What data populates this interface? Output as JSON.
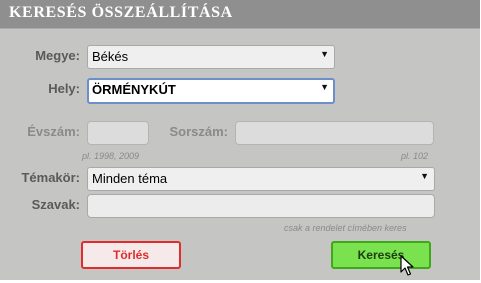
{
  "header": {
    "title": "KERESÉS ÖSSZEÁLLÍTÁSA"
  },
  "form": {
    "megye": {
      "label": "Megye:",
      "value": "Békés"
    },
    "hely": {
      "label": "Hely:",
      "value": "ÖRMÉNYKÚT"
    },
    "evszam": {
      "label": "Évszám:",
      "value": "",
      "hint": "pl. 1998, 2009"
    },
    "sorszam": {
      "label": "Sorszám:",
      "value": "",
      "hint": "pl. 102"
    },
    "temakor": {
      "label": "Témakör:",
      "value": "Minden téma"
    },
    "szavak": {
      "label": "Szavak:",
      "value": "",
      "hint": "csak a rendelet címében keres"
    }
  },
  "buttons": {
    "clear": "Törlés",
    "search": "Keresés"
  },
  "icons": {
    "dropdown": "▼",
    "cursor": "mouse-pointer-icon"
  },
  "colors": {
    "header_bg": "#8f8f8f",
    "panel_bg": "#c5c5c4",
    "clear_border": "#e02c2c",
    "search_bg": "#79e24e",
    "focus_border": "#6c8fc9"
  }
}
